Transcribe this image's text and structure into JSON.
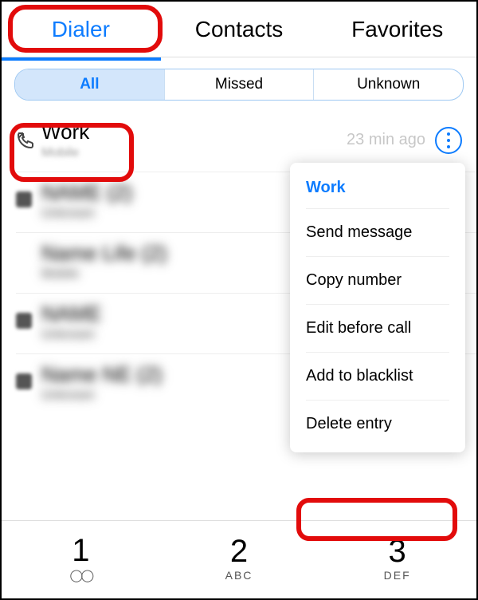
{
  "tabs": {
    "dialer": "Dialer",
    "contacts": "Contacts",
    "favorites": "Favorites",
    "active": "dialer"
  },
  "filters": {
    "all": "All",
    "missed": "Missed",
    "unknown": "Unknown",
    "active": "all"
  },
  "calls": [
    {
      "name": "Work",
      "sub": "Mobile",
      "time": "23 min ago",
      "blurred": false
    },
    {
      "name": "NAME (2)",
      "sub": "Unknown",
      "time": "",
      "blurred": true
    },
    {
      "name": "Name Life (2)",
      "sub": "Mobile",
      "time": "",
      "blurred": true
    },
    {
      "name": "NAME",
      "sub": "Unknown",
      "time": "",
      "blurred": true
    },
    {
      "name": "Name NE (2)",
      "sub": "Unknown",
      "time": "",
      "blurred": true
    }
  ],
  "context_menu": {
    "title": "Work",
    "items": {
      "send_message": "Send message",
      "copy_number": "Copy number",
      "edit_before_call": "Edit before call",
      "add_to_blacklist": "Add to blacklist",
      "delete_entry": "Delete entry"
    }
  },
  "dialpad": {
    "k1": {
      "digit": "1",
      "sub": ""
    },
    "k2": {
      "digit": "2",
      "sub": "ABC"
    },
    "k3": {
      "digit": "3",
      "sub": "DEF"
    }
  },
  "colors": {
    "accent": "#0d7cff",
    "highlight": "#e20b0b"
  }
}
